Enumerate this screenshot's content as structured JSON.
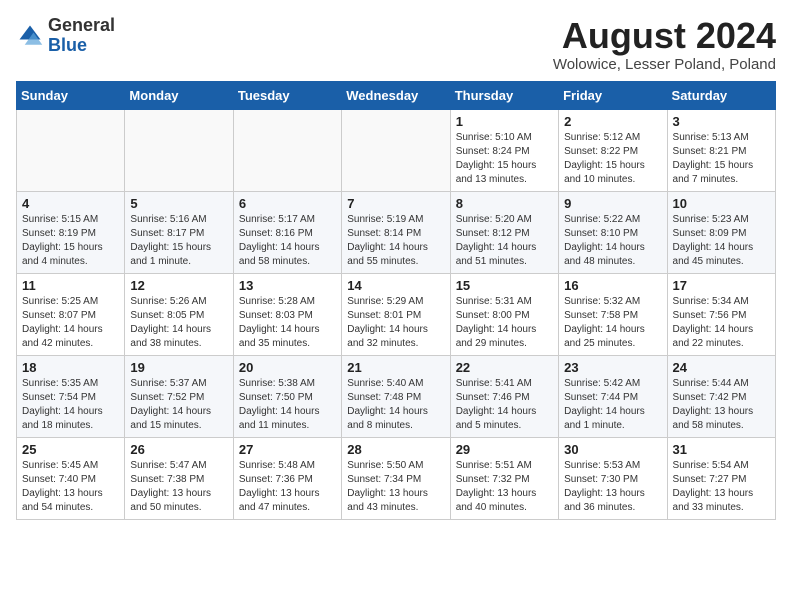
{
  "header": {
    "logo_general": "General",
    "logo_blue": "Blue",
    "month_year": "August 2024",
    "location": "Wolowice, Lesser Poland, Poland"
  },
  "days_of_week": [
    "Sunday",
    "Monday",
    "Tuesday",
    "Wednesday",
    "Thursday",
    "Friday",
    "Saturday"
  ],
  "weeks": [
    [
      {
        "day": "",
        "info": ""
      },
      {
        "day": "",
        "info": ""
      },
      {
        "day": "",
        "info": ""
      },
      {
        "day": "",
        "info": ""
      },
      {
        "day": "1",
        "info": "Sunrise: 5:10 AM\nSunset: 8:24 PM\nDaylight: 15 hours\nand 13 minutes."
      },
      {
        "day": "2",
        "info": "Sunrise: 5:12 AM\nSunset: 8:22 PM\nDaylight: 15 hours\nand 10 minutes."
      },
      {
        "day": "3",
        "info": "Sunrise: 5:13 AM\nSunset: 8:21 PM\nDaylight: 15 hours\nand 7 minutes."
      }
    ],
    [
      {
        "day": "4",
        "info": "Sunrise: 5:15 AM\nSunset: 8:19 PM\nDaylight: 15 hours\nand 4 minutes."
      },
      {
        "day": "5",
        "info": "Sunrise: 5:16 AM\nSunset: 8:17 PM\nDaylight: 15 hours\nand 1 minute."
      },
      {
        "day": "6",
        "info": "Sunrise: 5:17 AM\nSunset: 8:16 PM\nDaylight: 14 hours\nand 58 minutes."
      },
      {
        "day": "7",
        "info": "Sunrise: 5:19 AM\nSunset: 8:14 PM\nDaylight: 14 hours\nand 55 minutes."
      },
      {
        "day": "8",
        "info": "Sunrise: 5:20 AM\nSunset: 8:12 PM\nDaylight: 14 hours\nand 51 minutes."
      },
      {
        "day": "9",
        "info": "Sunrise: 5:22 AM\nSunset: 8:10 PM\nDaylight: 14 hours\nand 48 minutes."
      },
      {
        "day": "10",
        "info": "Sunrise: 5:23 AM\nSunset: 8:09 PM\nDaylight: 14 hours\nand 45 minutes."
      }
    ],
    [
      {
        "day": "11",
        "info": "Sunrise: 5:25 AM\nSunset: 8:07 PM\nDaylight: 14 hours\nand 42 minutes."
      },
      {
        "day": "12",
        "info": "Sunrise: 5:26 AM\nSunset: 8:05 PM\nDaylight: 14 hours\nand 38 minutes."
      },
      {
        "day": "13",
        "info": "Sunrise: 5:28 AM\nSunset: 8:03 PM\nDaylight: 14 hours\nand 35 minutes."
      },
      {
        "day": "14",
        "info": "Sunrise: 5:29 AM\nSunset: 8:01 PM\nDaylight: 14 hours\nand 32 minutes."
      },
      {
        "day": "15",
        "info": "Sunrise: 5:31 AM\nSunset: 8:00 PM\nDaylight: 14 hours\nand 29 minutes."
      },
      {
        "day": "16",
        "info": "Sunrise: 5:32 AM\nSunset: 7:58 PM\nDaylight: 14 hours\nand 25 minutes."
      },
      {
        "day": "17",
        "info": "Sunrise: 5:34 AM\nSunset: 7:56 PM\nDaylight: 14 hours\nand 22 minutes."
      }
    ],
    [
      {
        "day": "18",
        "info": "Sunrise: 5:35 AM\nSunset: 7:54 PM\nDaylight: 14 hours\nand 18 minutes."
      },
      {
        "day": "19",
        "info": "Sunrise: 5:37 AM\nSunset: 7:52 PM\nDaylight: 14 hours\nand 15 minutes."
      },
      {
        "day": "20",
        "info": "Sunrise: 5:38 AM\nSunset: 7:50 PM\nDaylight: 14 hours\nand 11 minutes."
      },
      {
        "day": "21",
        "info": "Sunrise: 5:40 AM\nSunset: 7:48 PM\nDaylight: 14 hours\nand 8 minutes."
      },
      {
        "day": "22",
        "info": "Sunrise: 5:41 AM\nSunset: 7:46 PM\nDaylight: 14 hours\nand 5 minutes."
      },
      {
        "day": "23",
        "info": "Sunrise: 5:42 AM\nSunset: 7:44 PM\nDaylight: 14 hours\nand 1 minute."
      },
      {
        "day": "24",
        "info": "Sunrise: 5:44 AM\nSunset: 7:42 PM\nDaylight: 13 hours\nand 58 minutes."
      }
    ],
    [
      {
        "day": "25",
        "info": "Sunrise: 5:45 AM\nSunset: 7:40 PM\nDaylight: 13 hours\nand 54 minutes."
      },
      {
        "day": "26",
        "info": "Sunrise: 5:47 AM\nSunset: 7:38 PM\nDaylight: 13 hours\nand 50 minutes."
      },
      {
        "day": "27",
        "info": "Sunrise: 5:48 AM\nSunset: 7:36 PM\nDaylight: 13 hours\nand 47 minutes."
      },
      {
        "day": "28",
        "info": "Sunrise: 5:50 AM\nSunset: 7:34 PM\nDaylight: 13 hours\nand 43 minutes."
      },
      {
        "day": "29",
        "info": "Sunrise: 5:51 AM\nSunset: 7:32 PM\nDaylight: 13 hours\nand 40 minutes."
      },
      {
        "day": "30",
        "info": "Sunrise: 5:53 AM\nSunset: 7:30 PM\nDaylight: 13 hours\nand 36 minutes."
      },
      {
        "day": "31",
        "info": "Sunrise: 5:54 AM\nSunset: 7:27 PM\nDaylight: 13 hours\nand 33 minutes."
      }
    ]
  ]
}
